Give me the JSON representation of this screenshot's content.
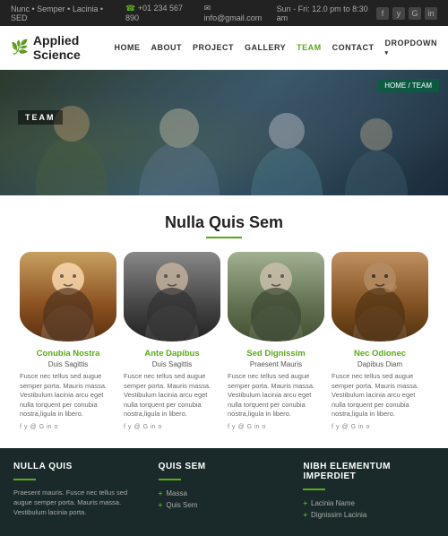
{
  "topbar": {
    "nav_left": "Nunc • Semper • Lacinia • SED",
    "phone": "+01 234 567 890",
    "email": "info@gmail.com",
    "hours": "Sun - Fri: 12.0 pm to 8:30 am",
    "social": [
      "f",
      "y",
      "G+",
      "in"
    ]
  },
  "header": {
    "logo_text": "Applied Science",
    "nav_items": [
      {
        "label": "HOME",
        "active": false
      },
      {
        "label": "ABOUT",
        "active": false
      },
      {
        "label": "PROJECT",
        "active": false
      },
      {
        "label": "GALLERY",
        "active": false
      },
      {
        "label": "TEAM",
        "active": true
      },
      {
        "label": "CONTACT",
        "active": false
      },
      {
        "label": "DROPDOWN",
        "active": false,
        "has_dropdown": true
      }
    ]
  },
  "hero": {
    "label": "TEAM",
    "breadcrumb": "HOME / TEAM"
  },
  "team_section": {
    "title": "Nulla Quis Sem",
    "members": [
      {
        "name": "Conubia Nostra",
        "role": "Duis Sagittis",
        "desc": "Fusce nec tellus sed augue semper porta. Mauris massa. Vestibulum lacinia arcu eget nulla torquent per conubia nostra,ligula in libero.",
        "social": [
          "f",
          "y",
          "@",
          "G",
          "in",
          "o"
        ]
      },
      {
        "name": "Ante Dapibus",
        "role": "Duis Sagittis",
        "desc": "Fusce nec tellus sed augue semper porta. Mauris massa. Vestibulum lacinia arcu eget nulla torquent per conubia nostra,ligula in libero.",
        "social": [
          "f",
          "y",
          "@",
          "G",
          "in",
          "o"
        ]
      },
      {
        "name": "Sed Dignissim",
        "role": "Praesent Mauris",
        "desc": "Fusce nec tellus sed augue semper porta. Mauris massa. Vestibulum lacinia arcu eget nulla torquent per conubia nostra,ligula in libero.",
        "social": [
          "f",
          "y",
          "@",
          "G",
          "in",
          "o"
        ]
      },
      {
        "name": "Nec Odionec",
        "role": "Dapibus Diam",
        "desc": "Fusce nec tellus sed augue semper porta. Mauris massa. Vestibulum lacinia arcu eget nulla torquent per conubia nostra,ligula in libero.",
        "social": [
          "f",
          "y",
          "@",
          "G",
          "in",
          "o"
        ]
      }
    ]
  },
  "footer": {
    "cols": [
      {
        "title": "NULLA QUIS",
        "text": "Praesent mauris. Fusce nec tellus sed augue semper porta. Mauris massa. Vestibulum lacinia porta.",
        "items": []
      },
      {
        "title": "QUIS SEM",
        "text": "",
        "items": [
          "Massa",
          "Quis Sem"
        ]
      },
      {
        "title": "NIBH ELEMENTUM IMPERDIET",
        "text": "",
        "items": [
          "Lacinia Name",
          "Dignissim Lacinia"
        ]
      }
    ]
  }
}
